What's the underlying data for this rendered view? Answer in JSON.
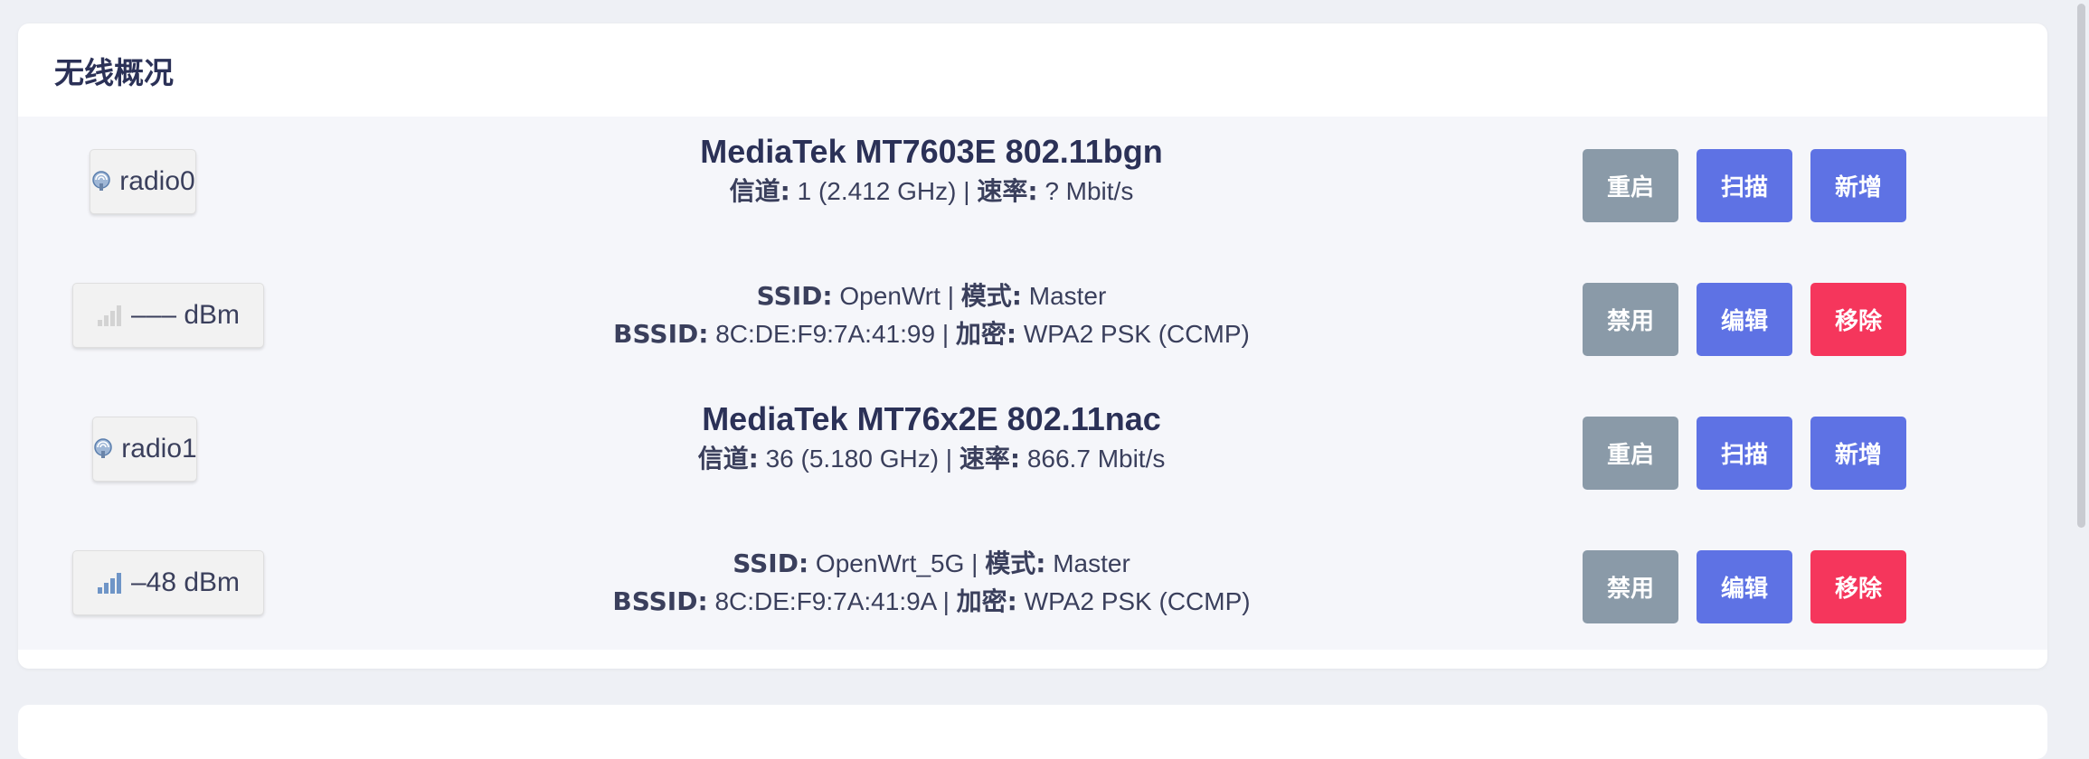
{
  "card": {
    "title": "无线概况"
  },
  "rows": [
    {
      "badge": {
        "label": "radio0",
        "icon": "wifi-radio-icon"
      },
      "title": "MediaTek MT7603E 802.11bgn",
      "ch_label": "信道:",
      "ch_value": "1 (2.412 GHz)",
      "sep": "|",
      "rate_label": "速率:",
      "rate_value": "? Mbit/s",
      "buttons": [
        "重启",
        "扫描",
        "新增"
      ]
    },
    {
      "badge": {
        "label": "––– dBm",
        "icon": "signal-none-icon",
        "signal_level": 0
      },
      "ssid_label": "SSID:",
      "ssid_value": "OpenWrt",
      "mode_label": "模式:",
      "mode_value": "Master",
      "bssid_label": "BSSID:",
      "bssid_value": "8C:DE:F9:7A:41:99",
      "enc_label": "加密:",
      "enc_value": "WPA2 PSK (CCMP)",
      "sep": "|",
      "buttons": [
        "禁用",
        "编辑",
        "移除"
      ]
    },
    {
      "badge": {
        "label": "radio1",
        "icon": "wifi-radio-icon"
      },
      "title": "MediaTek MT76x2E 802.11nac",
      "ch_label": "信道:",
      "ch_value": "36 (5.180 GHz)",
      "sep": "|",
      "rate_label": "速率:",
      "rate_value": "866.7 Mbit/s",
      "buttons": [
        "重启",
        "扫描",
        "新增"
      ]
    },
    {
      "badge": {
        "label": "–48 dBm",
        "icon": "signal-full-icon",
        "signal_level": 1
      },
      "ssid_label": "SSID:",
      "ssid_value": "OpenWrt_5G",
      "mode_label": "模式:",
      "mode_value": "Master",
      "bssid_label": "BSSID:",
      "bssid_value": "8C:DE:F9:7A:41:9A",
      "enc_label": "加密:",
      "enc_value": "WPA2 PSK (CCMP)",
      "sep": "|",
      "buttons": [
        "禁用",
        "编辑",
        "移除"
      ]
    }
  ],
  "colors": {
    "accent": "#5e72e4",
    "danger": "#f5365c",
    "neutral": "#8a9aa8"
  }
}
